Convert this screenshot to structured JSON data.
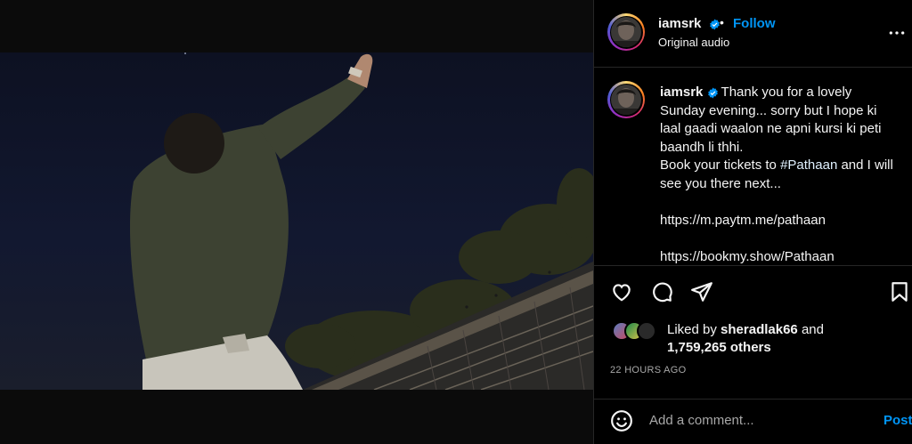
{
  "post": {
    "username": "iamsrk",
    "follow_label": "Follow",
    "separator": "•",
    "audio_label": "Original audio"
  },
  "caption": {
    "username": "iamsrk",
    "text_before": "Thank you for a lovely Sunday evening... sorry but I hope ki laal gaadi waalon ne apni kursi ki peti baandh li thhi.\nBook your tickets to ",
    "hashtag": "#Pathaan",
    "text_after": " and I will see you there next...\n\nhttps://m.paytm.me/pathaan\n\nhttps://bookmy.show/Pathaan"
  },
  "likes": {
    "prefix": "Liked by ",
    "user": "sheradlak66",
    "middle": " and",
    "count": "1,759,265 others"
  },
  "timestamp": "22 HOURS AGO",
  "comment": {
    "placeholder": "Add a comment...",
    "post_label": "Post"
  },
  "icons": {
    "more": "more-options-icon",
    "like": "heart-icon",
    "comment": "comment-icon",
    "share": "share-icon",
    "save": "bookmark-icon",
    "emoji": "emoji-icon",
    "mute": "muted-speaker-icon",
    "verified": "verified-badge-icon"
  },
  "colors": {
    "accent": "#0095f6",
    "background": "#000000",
    "divider": "#262626",
    "muted_text": "#a8a8a8"
  }
}
